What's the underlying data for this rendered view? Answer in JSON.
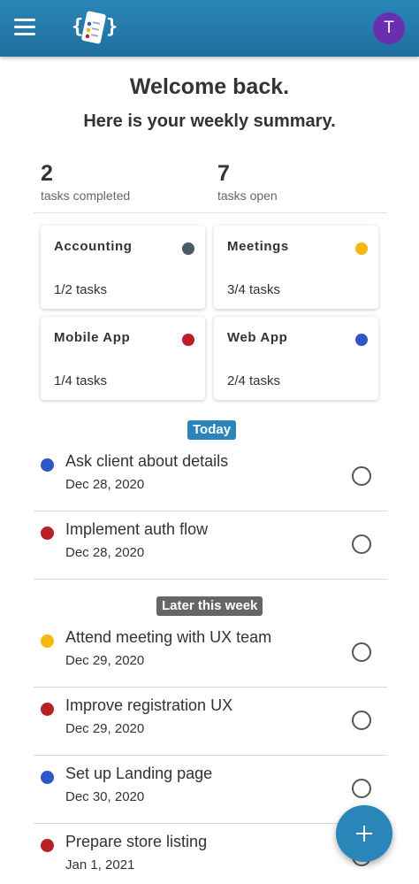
{
  "header": {
    "menu_icon": "hamburger-menu-icon",
    "logo_icon": "app-logo-icon",
    "avatar_initial": "T",
    "bar_color": "#1f6f9e",
    "avatar_color": "#6a2fb0"
  },
  "greeting": {
    "title": "Welcome back.",
    "subtitle": "Here is your weekly summary."
  },
  "stats": {
    "completed_value": "2",
    "completed_label": "tasks completed",
    "open_value": "7",
    "open_label": "tasks open"
  },
  "projects": [
    {
      "name": "Accounting",
      "count": "1/2 tasks",
      "color": "#4a5a63"
    },
    {
      "name": "Meetings",
      "count": "3/4 tasks",
      "color": "#f4b70e"
    },
    {
      "name": "Mobile App",
      "count": "1/4 tasks",
      "color": "#b82024"
    },
    {
      "name": "Web App",
      "count": "2/4 tasks",
      "color": "#2d56c8"
    }
  ],
  "sections": {
    "today": {
      "label": "Today",
      "color": "#2a86b8"
    },
    "later": {
      "label": "Later this week",
      "color": "#666666"
    }
  },
  "tasks": [
    {
      "name": "Ask client about details",
      "date": "Dec 28, 2020",
      "color": "#2d56c8"
    },
    {
      "name": "Implement auth flow",
      "date": "Dec 28, 2020",
      "color": "#b82024"
    },
    {
      "name": "Attend meeting with UX team",
      "date": "Dec 29, 2020",
      "color": "#f4b70e"
    },
    {
      "name": "Improve registration UX",
      "date": "Dec 29, 2020",
      "color": "#b82024"
    },
    {
      "name": "Set up Landing page",
      "date": "Dec 30, 2020",
      "color": "#2d56c8"
    },
    {
      "name": "Prepare store listing",
      "date": "Jan 1, 2021",
      "color": "#b82024"
    }
  ],
  "fab": {
    "icon": "plus-icon"
  }
}
